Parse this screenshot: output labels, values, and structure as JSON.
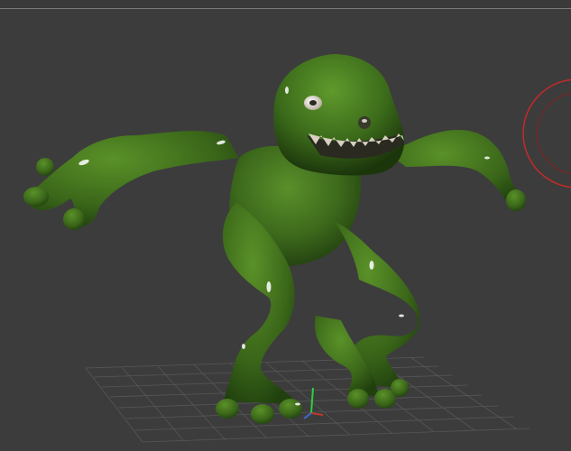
{
  "app": {
    "view": "perspective-viewport"
  },
  "scene": {
    "object": "green-frog-creature-model",
    "material_color": "#3f6b1e",
    "background_color": "#3c3c3c",
    "grid_color": "#5a5a5a",
    "gizmo_colors": {
      "x_axis": "#c0392b",
      "y_axis": "#2ecc40",
      "z_axis": "#3a6bd6",
      "rotate_ring": "#c42a2a"
    }
  }
}
